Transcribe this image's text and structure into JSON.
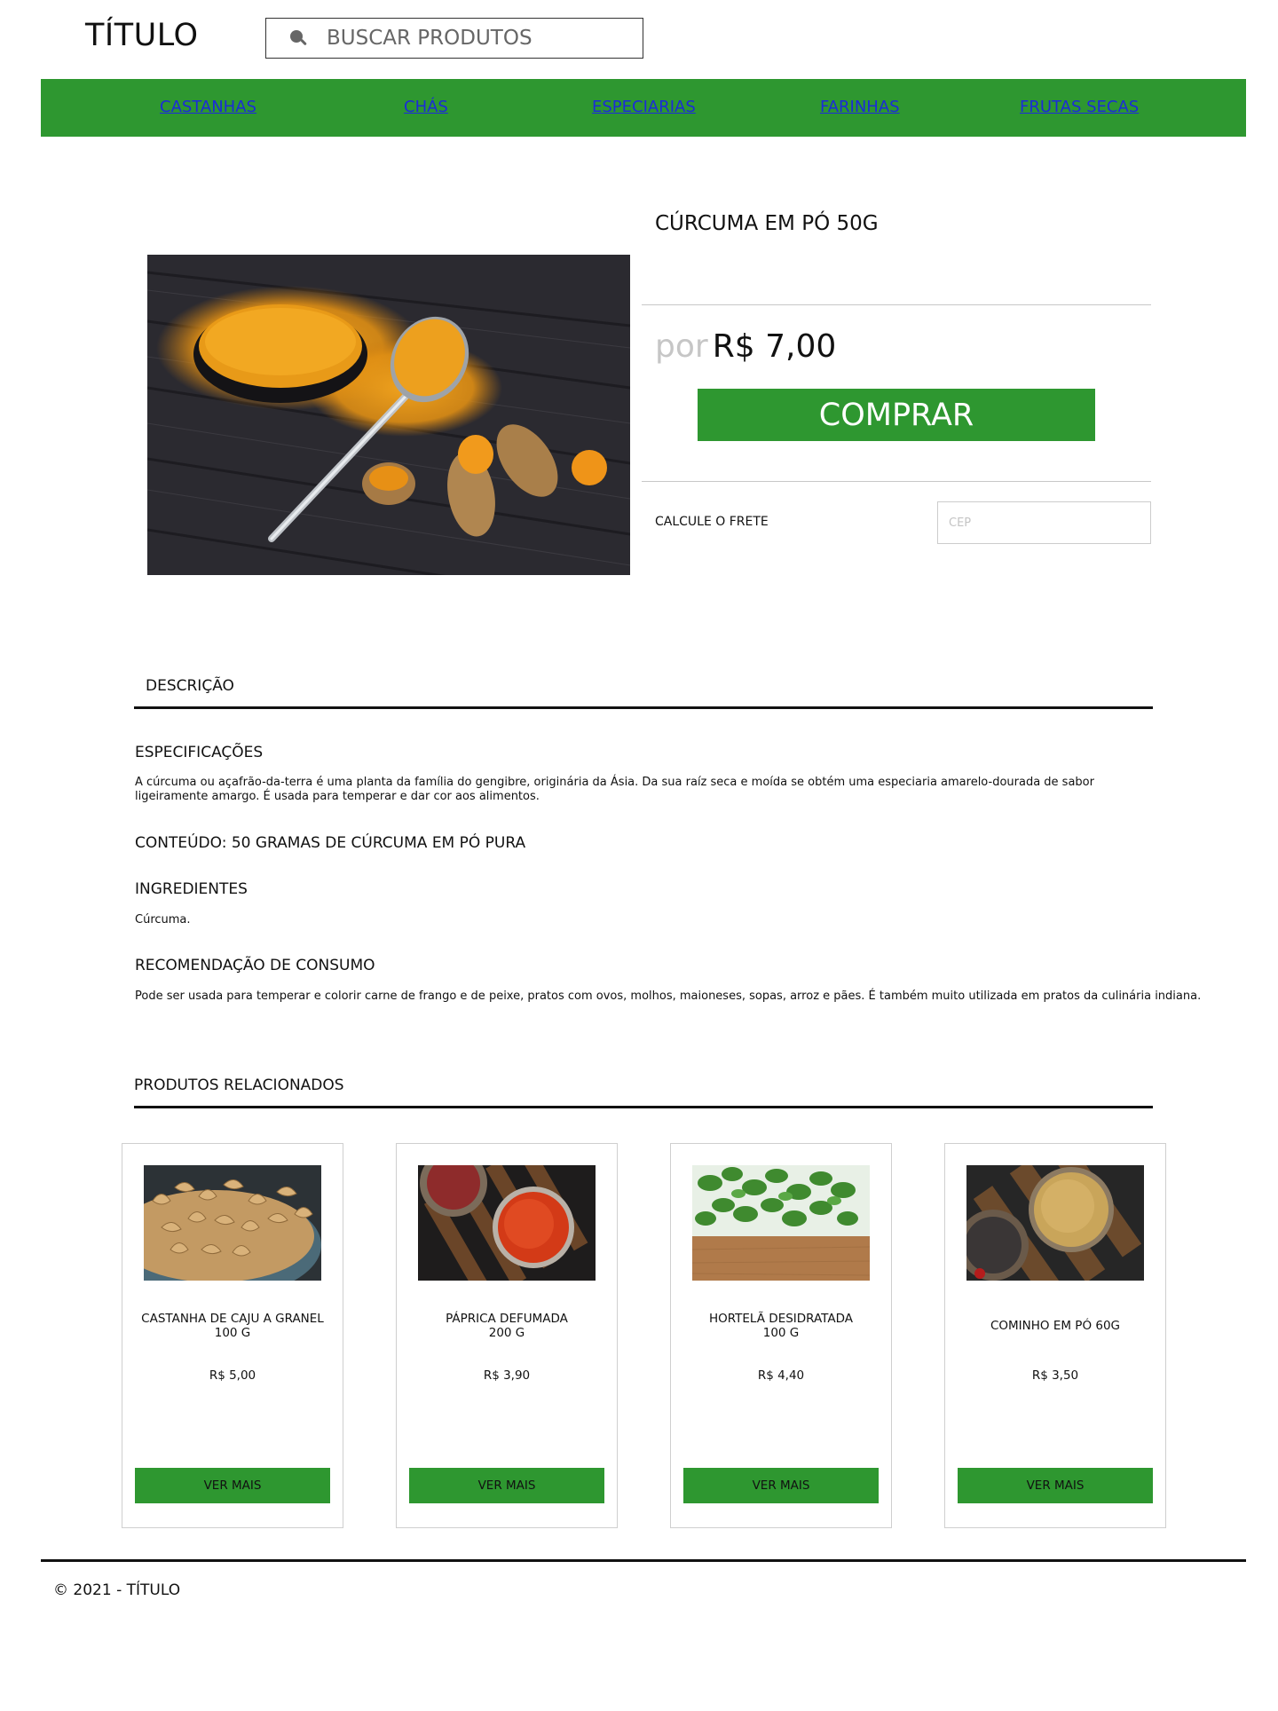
{
  "header": {
    "title": "TÍTULO",
    "search_placeholder": "BUSCAR PRODUTOS"
  },
  "nav": {
    "items": [
      "CASTANHAS",
      "CHÁS",
      "ESPECIARIAS",
      "FARINHAS",
      "FRUTAS SECAS"
    ]
  },
  "product": {
    "title": "CÚRCUMA EM PÓ 50G",
    "price_prefix": "por",
    "price": "R$ 7,00",
    "buy_label": "COMPRAR",
    "shipping_label": "CALCULE O FRETE",
    "cep_placeholder": "CEP"
  },
  "description": {
    "tab_label": "DESCRIÇÃO",
    "spec_heading": "ESPECIFICAÇÕES",
    "spec_text": "A cúrcuma ou açafrão-da-terra é uma planta da família do gengibre, originária da Ásia. Da sua raíz seca e moída se obtém uma especiaria amarelo-dourada de sabor ligeiramente amargo. É usada para temperar e dar cor aos alimentos.",
    "content_heading": "CONTEÚDO: 50 GRAMAS DE CÚRCUMA EM PÓ PURA",
    "ingredients_heading": "INGREDIENTES",
    "ingredients_text": "Cúrcuma.",
    "recommendation_heading": "RECOMENDAÇÃO DE CONSUMO",
    "recommendation_text": "Pode ser usada para temperar e colorir carne de frango e de peixe,  pratos com ovos, molhos, maioneses, sopas, arroz e pães. É também muito utilizada em pratos da culinária indiana."
  },
  "related": {
    "heading": "PRODUTOS RELACIONADOS",
    "products": [
      {
        "name_line1": "CASTANHA DE CAJU A GRANEL",
        "name_line2": "100 G",
        "price": "R$ 5,00",
        "button": "VER MAIS"
      },
      {
        "name_line1": "PÁPRICA DEFUMADA",
        "name_line2": "200 G",
        "price": "R$ 3,90",
        "button": "VER MAIS"
      },
      {
        "name_line1": "HORTELÃ DESIDRATADA",
        "name_line2": "100 G",
        "price": "R$ 4,40",
        "button": "VER MAIS"
      },
      {
        "name_line1": "COMINHO EM PÓ 60G",
        "name_line2": "",
        "price": "R$ 3,50",
        "button": "VER MAIS"
      }
    ]
  },
  "footer": {
    "text": "© 2021 - TÍTULO"
  },
  "colors": {
    "brand_green": "#2e9730",
    "nav_link": "#1b2bd9",
    "price_prefix": "#c6c6c6"
  }
}
